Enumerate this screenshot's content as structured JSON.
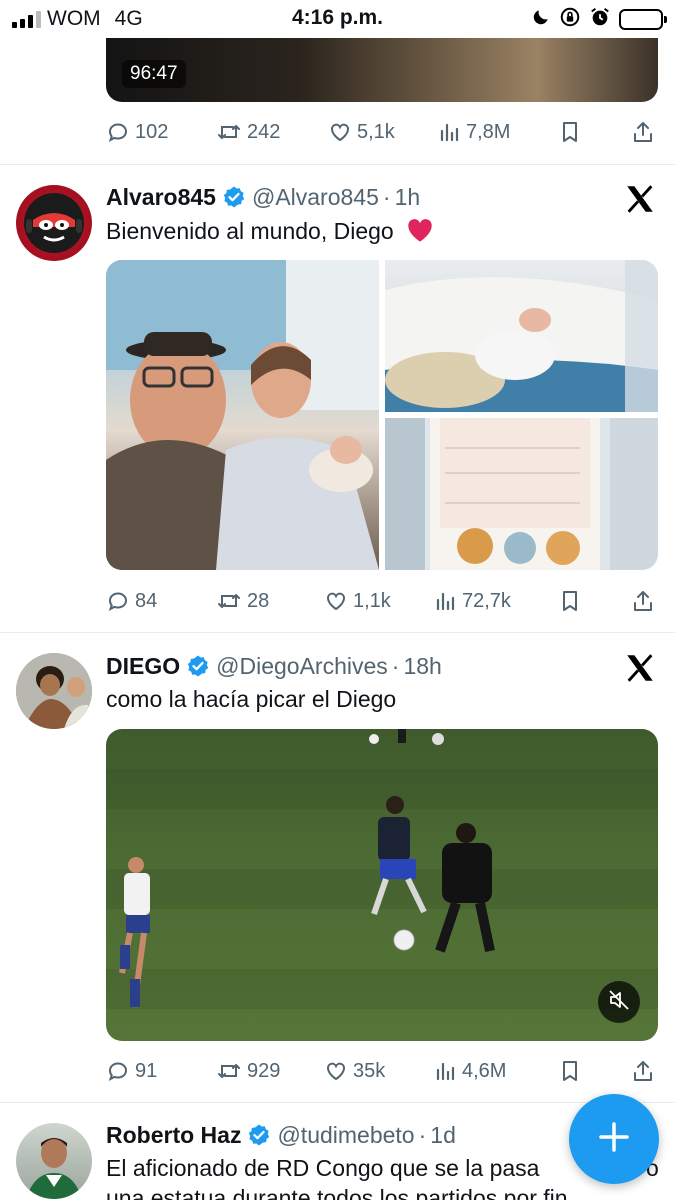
{
  "status_bar": {
    "carrier": "WOM",
    "network": "4G",
    "time": "4:16 p.m.",
    "icons": [
      "signal-icon",
      "moon-icon",
      "rotation-lock-icon",
      "alarm-icon",
      "battery-icon"
    ],
    "battery_color": "#ffd60a"
  },
  "colors": {
    "accent": "#1d9bf0",
    "secondary_text": "#536471",
    "heart_red": "#e0245e"
  },
  "tweets": [
    {
      "media": {
        "type": "video",
        "duration": "96:47"
      },
      "stats": {
        "replies": "102",
        "reposts": "242",
        "likes": "5,1k",
        "views": "7,8M"
      }
    },
    {
      "name": "Alvaro845",
      "handle": "@Alvaro845",
      "separator": "·",
      "time": "1h",
      "text": "Bienvenido al mundo, Diego",
      "emoji_icon": "red-heart-icon",
      "media": {
        "type": "photo-grid",
        "count": 3
      },
      "stats": {
        "replies": "84",
        "reposts": "28",
        "likes": "1,1k",
        "views": "72,7k"
      }
    },
    {
      "name": "DIEGO",
      "handle": "@DiegoArchives",
      "separator": "·",
      "time": "18h",
      "text": "como la hacía picar el Diego",
      "media": {
        "type": "video",
        "muted": true
      },
      "stats": {
        "replies": "91",
        "reposts": "929",
        "likes": "35k",
        "views": "4,6M"
      }
    },
    {
      "name": "Roberto Haz",
      "handle": "@tudimebeto",
      "separator": "·",
      "time": "1d",
      "text_line1": "El aficionado de RD Congo que se la pasa",
      "text_line1_end": "o",
      "text_line2": "una estatua durante todos los partidos por fin"
    }
  ],
  "fab": {
    "icon": "plus-icon"
  }
}
